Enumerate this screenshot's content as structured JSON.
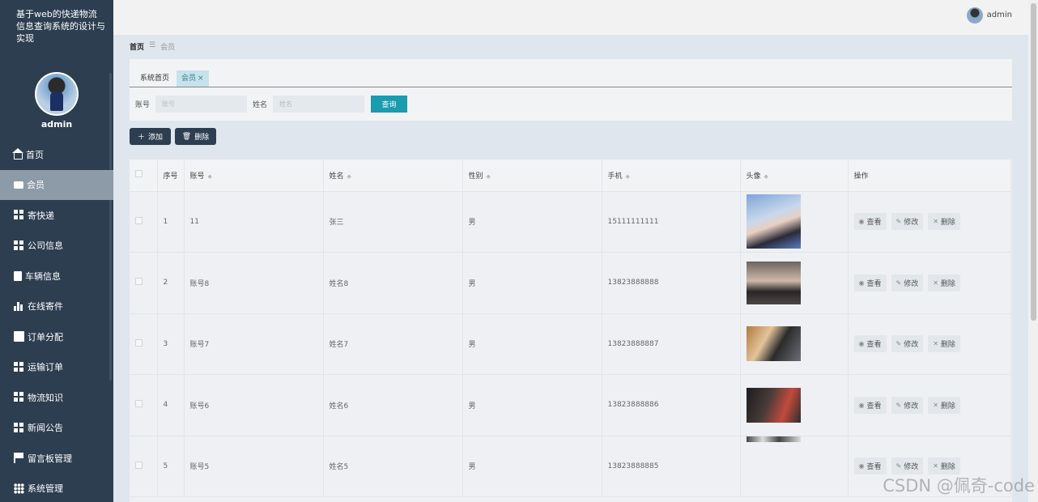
{
  "app": {
    "title": "基于web的快递物流信息查询系统的设计与实现",
    "side_user": "admin"
  },
  "topbar": {
    "user": "admin"
  },
  "nav": [
    {
      "label": "首页",
      "icon": "home-icon",
      "active": false
    },
    {
      "label": "会员",
      "icon": "chat-icon",
      "active": true
    },
    {
      "label": "寄快递",
      "icon": "grid-icon",
      "active": false
    },
    {
      "label": "公司信息",
      "icon": "grid-icon",
      "active": false
    },
    {
      "label": "车辆信息",
      "icon": "clipboard-icon",
      "active": false
    },
    {
      "label": "在线寄件",
      "icon": "bar-chart-icon",
      "active": false
    },
    {
      "label": "订单分配",
      "icon": "trend-chart-icon",
      "active": false
    },
    {
      "label": "运输订单",
      "icon": "grid-icon",
      "active": false
    },
    {
      "label": "物流知识",
      "icon": "grid-icon",
      "active": false
    },
    {
      "label": "新闻公告",
      "icon": "grid-icon",
      "active": false
    },
    {
      "label": "留言板管理",
      "icon": "flag-icon",
      "active": false
    },
    {
      "label": "系统管理",
      "icon": "apps-icon",
      "active": false
    }
  ],
  "breadcrumb": {
    "home": "首页",
    "sep": "☰",
    "current": "会员"
  },
  "tabs": {
    "home": "系统首页",
    "active": "会员",
    "close": "×"
  },
  "search": {
    "account_label": "账号",
    "account_placeholder": "账号",
    "name_label": "姓名",
    "name_placeholder": "姓名",
    "query_button": "查询"
  },
  "actions": {
    "add": "添加",
    "delete": "删除"
  },
  "table": {
    "headers": {
      "index": "序号",
      "account": "账号",
      "name": "姓名",
      "gender": "性别",
      "phone": "手机",
      "avatar": "头像",
      "ops": "操作"
    },
    "rows": [
      {
        "index": "1",
        "account": "11",
        "name": "张三",
        "gender": "男",
        "phone": "15111111111"
      },
      {
        "index": "2",
        "account": "账号8",
        "name": "姓名8",
        "gender": "男",
        "phone": "13823888888"
      },
      {
        "index": "3",
        "account": "账号7",
        "name": "姓名7",
        "gender": "男",
        "phone": "13823888887"
      },
      {
        "index": "4",
        "account": "账号6",
        "name": "姓名6",
        "gender": "男",
        "phone": "13823888886"
      },
      {
        "index": "5",
        "account": "账号5",
        "name": "姓名5",
        "gender": "男",
        "phone": "13823888885"
      }
    ],
    "op_labels": {
      "view": "查看",
      "edit": "修改",
      "delete": "删除"
    }
  },
  "watermark": "CSDN @佩奇-code"
}
